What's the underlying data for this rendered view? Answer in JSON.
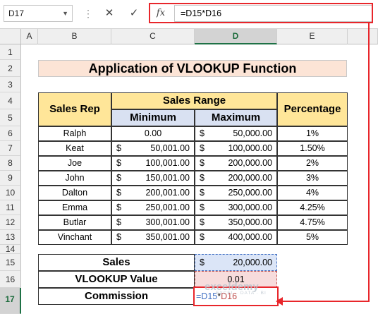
{
  "formula_bar": {
    "name_box": "D17",
    "cancel_icon": "✕",
    "enter_icon": "✓",
    "fx_label": "fx",
    "formula": "=D15*D16"
  },
  "columns": [
    "A",
    "B",
    "C",
    "D",
    "E"
  ],
  "rows": [
    "1",
    "2",
    "3",
    "4",
    "5",
    "6",
    "7",
    "8",
    "9",
    "10",
    "11",
    "12",
    "13",
    "14",
    "15",
    "16",
    "17"
  ],
  "title": "Application of VLOOKUP Function",
  "table": {
    "header_rep": "Sales Rep",
    "header_range": "Sales Range",
    "header_min": "Minimum",
    "header_max": "Maximum",
    "header_pct": "Percentage",
    "currency": "$",
    "rows": [
      {
        "rep": "Ralph",
        "min_cur": "",
        "min": "0.00",
        "max_cur": "$",
        "max": "50,000.00",
        "pct": "1%"
      },
      {
        "rep": "Keat",
        "min_cur": "$",
        "min": "50,001.00",
        "max_cur": "$",
        "max": "100,000.00",
        "pct": "1.50%"
      },
      {
        "rep": "Joe",
        "min_cur": "$",
        "min": "100,001.00",
        "max_cur": "$",
        "max": "200,000.00",
        "pct": "2%"
      },
      {
        "rep": "John",
        "min_cur": "$",
        "min": "150,001.00",
        "max_cur": "$",
        "max": "200,000.00",
        "pct": "3%"
      },
      {
        "rep": "Dalton",
        "min_cur": "$",
        "min": "200,001.00",
        "max_cur": "$",
        "max": "250,000.00",
        "pct": "4%"
      },
      {
        "rep": "Emma",
        "min_cur": "$",
        "min": "250,001.00",
        "max_cur": "$",
        "max": "300,000.00",
        "pct": "4.25%"
      },
      {
        "rep": "Butlar",
        "min_cur": "$",
        "min": "300,001.00",
        "max_cur": "$",
        "max": "350,000.00",
        "pct": "4.75%"
      },
      {
        "rep": "Vinchant",
        "min_cur": "$",
        "min": "350,001.00",
        "max_cur": "$",
        "max": "400,000.00",
        "pct": "5%"
      }
    ]
  },
  "summary": {
    "sales_label": "Sales",
    "sales_cur": "$",
    "sales_value": "20,000.00",
    "vlookup_label": "VLOOKUP Value",
    "vlookup_value": "0.01",
    "commission_label": "Commission",
    "commission_formula_a": "=D15",
    "commission_formula_op": "*",
    "commission_formula_b": "D16"
  },
  "watermark": {
    "name": "exceldemy",
    "tagline": "EXCEL · DATA · BI"
  },
  "colors": {
    "accent_red": "#e8262b",
    "header_yellow": "#ffe699",
    "subheader_blue": "#d9e1f2",
    "title_peach": "#fce4d6",
    "ref_blue": "#4472c4",
    "ref_red": "#c0504d"
  }
}
